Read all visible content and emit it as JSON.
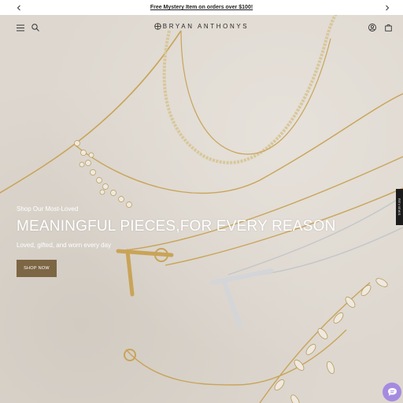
{
  "announcement": {
    "text": "Free Mystery Item on orders over $100!",
    "prev_icon": "chevron-left-icon",
    "next_icon": "chevron-right-icon"
  },
  "header": {
    "logo_text": "BRYAN ANTHONYS",
    "icons": [
      "menu-icon",
      "search-icon",
      "account-icon",
      "cart-icon"
    ]
  },
  "hero": {
    "eyebrow": "Shop Our Most-Loved",
    "title": "MEANINGFUL PIECES,FOR EVERY REASON",
    "description": "Loved, gifted, and worn every day",
    "button_label": "SHOP NOW",
    "button_color": "#7c6644"
  },
  "side_tab": {
    "label": "REVIEWS"
  },
  "chat": {
    "icon": "chat-icon",
    "color": "#a58be0"
  }
}
